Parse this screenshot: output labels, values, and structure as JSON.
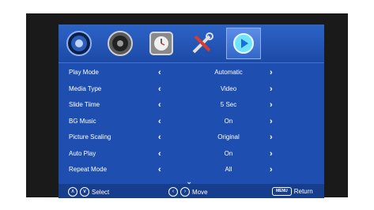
{
  "tabs": [
    {
      "name": "picture-icon"
    },
    {
      "name": "sound-icon"
    },
    {
      "name": "time-icon"
    },
    {
      "name": "setup-icon"
    },
    {
      "name": "media-icon"
    }
  ],
  "rows": [
    {
      "label": "Play Mode",
      "value": "Automatic"
    },
    {
      "label": "Media Type",
      "value": "Video"
    },
    {
      "label": "Slide Tiime",
      "value": "5 Sec"
    },
    {
      "label": "BG Music",
      "value": "On"
    },
    {
      "label": "Picture Scaling",
      "value": "Original"
    },
    {
      "label": "Auto Play",
      "value": "On"
    },
    {
      "label": "Repeat Mode",
      "value": "All"
    }
  ],
  "footer": {
    "select_label": "Select",
    "move_label": "Move",
    "menu_key": "MENU",
    "return_label": "Return"
  },
  "colors": {
    "panel_bg": "#1e4fb0",
    "footer_bg": "#163e8d"
  }
}
